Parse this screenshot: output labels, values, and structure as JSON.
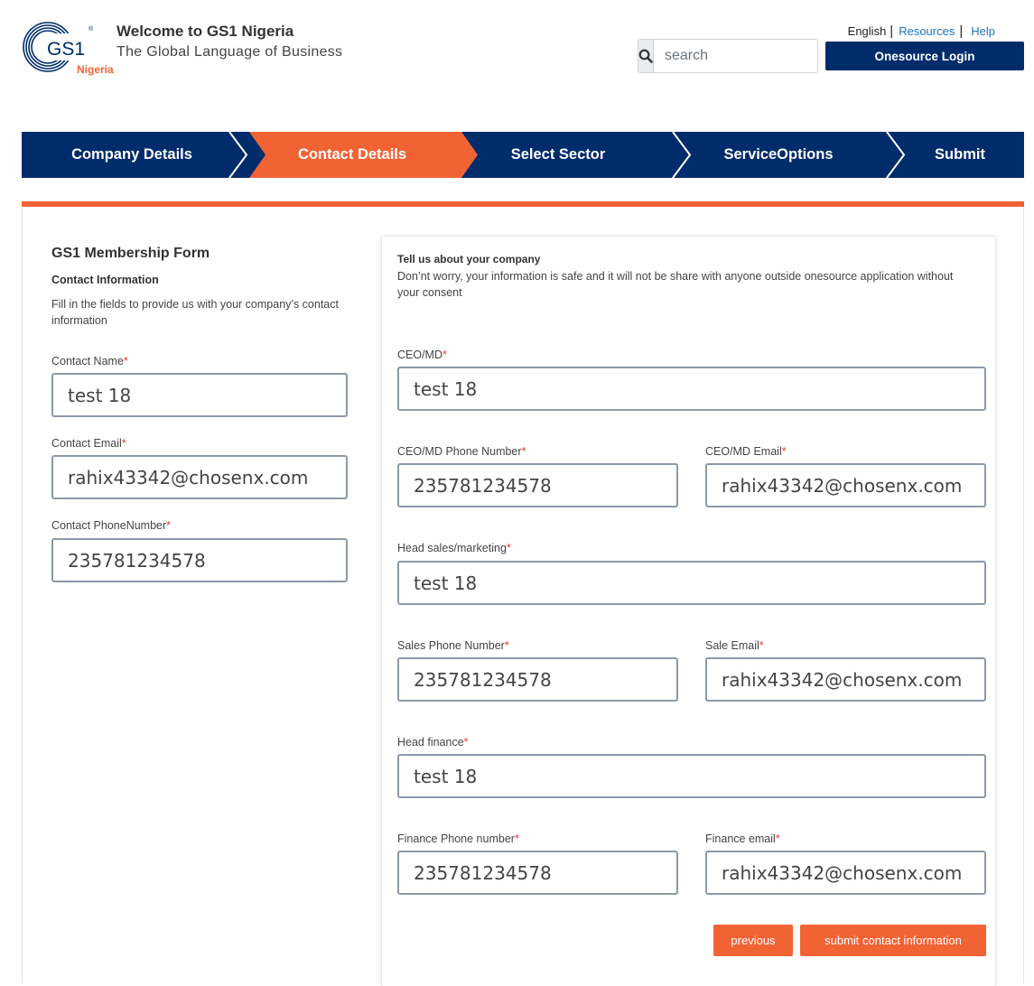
{
  "header": {
    "logo_text": "GS1",
    "logo_country": "Nigeria",
    "welcome": "Welcome to GS1 Nigeria",
    "tagline": "The Global Language of Business",
    "links": {
      "language": "English",
      "resources": "Resources",
      "help": "Help"
    },
    "search_placeholder": "search",
    "login_label": "Onesource Login"
  },
  "steps": [
    {
      "label": "Company Details",
      "active": false
    },
    {
      "label": "Contact Details",
      "active": true
    },
    {
      "label": "Select Sector",
      "active": false
    },
    {
      "label": "ServiceOptions",
      "active": false
    },
    {
      "label": "Submit",
      "active": false
    }
  ],
  "left": {
    "form_title": "GS1 Membership Form",
    "section_title": "Contact Information",
    "section_desc": "Fill in the fields to provide us with your company’s contact information",
    "fields": {
      "contact_name": {
        "label": "Contact Name",
        "value": "test 18"
      },
      "contact_email": {
        "label": "Contact Email",
        "value": "rahix43342@chosenx.com"
      },
      "contact_phone": {
        "label": "Contact PhoneNumber",
        "value": "235781234578"
      }
    }
  },
  "panel": {
    "title": "Tell us about your company",
    "desc": "Don’nt worry, your information is safe and it will not be share with anyone outside onesource application without your consent",
    "fields": {
      "ceo": {
        "label": "CEO/MD",
        "value": "test 18"
      },
      "ceo_phone": {
        "label": "CEO/MD Phone Number",
        "value": "235781234578"
      },
      "ceo_email": {
        "label": "CEO/MD Email",
        "value": "rahix43342@chosenx.com"
      },
      "head_sales": {
        "label": "Head sales/marketing",
        "value": "test 18"
      },
      "sales_phone": {
        "label": "Sales Phone Number",
        "value": "235781234578"
      },
      "sales_email": {
        "label": "Sale Email",
        "value": "rahix43342@chosenx.com"
      },
      "head_finance": {
        "label": "Head finance",
        "value": "test 18"
      },
      "finance_phone": {
        "label": "Finance Phone number",
        "value": "235781234578"
      },
      "finance_email": {
        "label": "Finance email",
        "value": "rahix43342@chosenx.com"
      }
    },
    "required_marker": "*",
    "previous_label": "previous",
    "submit_label": "submit contact information"
  },
  "colors": {
    "navy": "#002c6c",
    "orange": "#f26334",
    "link": "#1b75bc"
  },
  "icons": {
    "search": "search-icon",
    "logo": "gs1-logo-icon"
  }
}
